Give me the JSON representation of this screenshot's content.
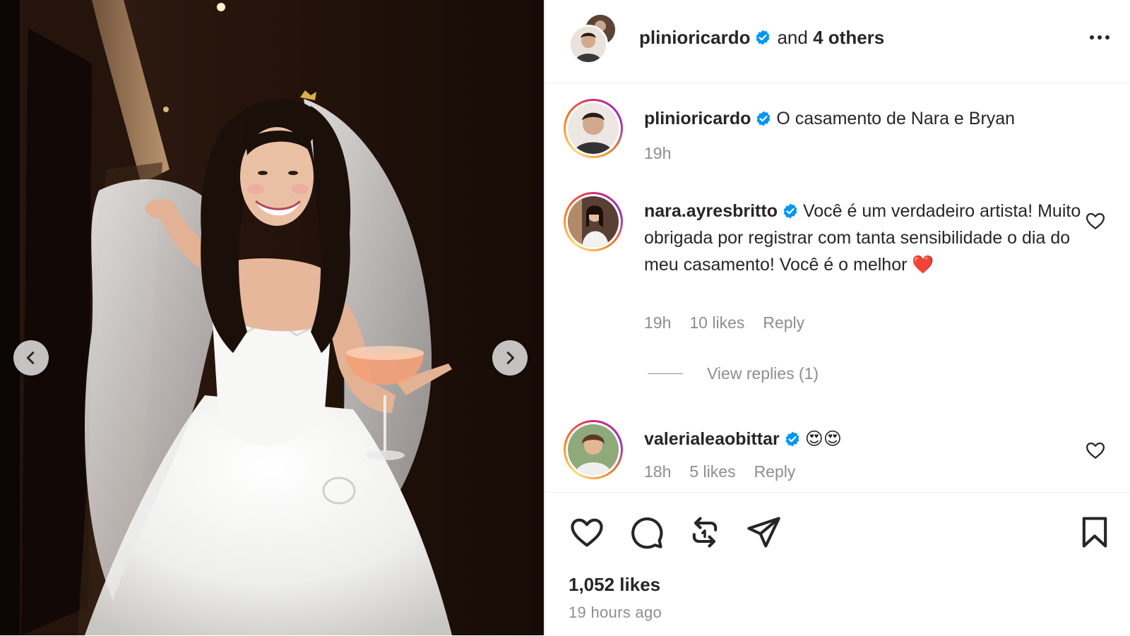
{
  "post": {
    "author": "plinioricardo",
    "collab_text_pre": "and",
    "collab_text_count": "4 others",
    "more_label": "..."
  },
  "comments": [
    {
      "username": "plinioricardo",
      "text": "O casamento de Nara e Bryan",
      "time": "19h"
    },
    {
      "username": "nara.ayresbritto",
      "text": "Você é um verdadeiro artista! Muito obrigada por registrar com tanta sensibilidade o dia do meu casamento! Você é o melhor",
      "emoji": "❤️",
      "time": "19h",
      "likes": "10 likes",
      "reply_label": "Reply",
      "view_replies": "View replies (1)"
    },
    {
      "username": "valerialeaobittar",
      "text": "😍😍",
      "time": "18h",
      "likes": "5 likes",
      "reply_label": "Reply"
    }
  ],
  "stats": {
    "likes": "1,052 likes",
    "time_ago": "19 hours ago"
  },
  "icons": {
    "verified": "verified-badge-icon",
    "like": "heart-icon",
    "comment": "comment-bubble-icon",
    "repost": "repost-icon",
    "share": "paper-plane-icon",
    "save": "bookmark-icon",
    "prev": "chevron-left-icon",
    "next": "chevron-right-icon"
  },
  "colors": {
    "verified_blue": "#0095f6",
    "text_primary": "#262626",
    "text_secondary": "#8e8e8e",
    "divider": "#efefef"
  }
}
